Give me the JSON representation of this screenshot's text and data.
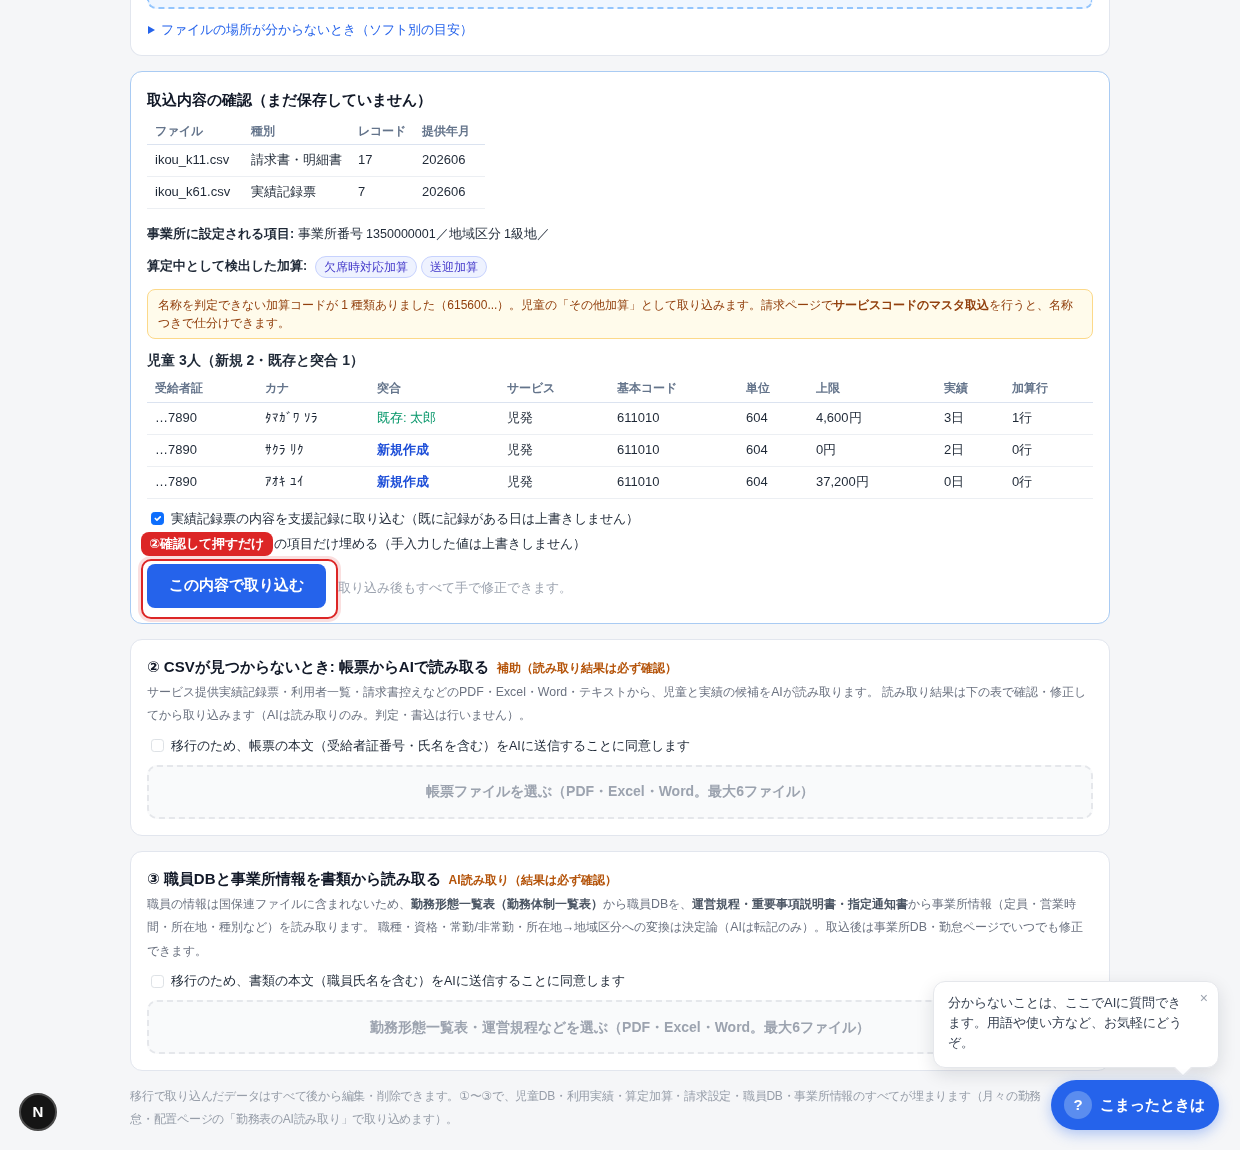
{
  "top_card": {
    "help_toggle": {
      "label": "ファイルの場所が分からないとき（ソフト別の目安）",
      "expanded": false
    }
  },
  "review_card": {
    "title": "取込内容の確認（まだ保存していません）",
    "files_table": {
      "columns": [
        "ファイル",
        "種別",
        "レコード",
        "提供年月"
      ],
      "rows": [
        [
          "ikou_k11.csv",
          "請求書・明細書",
          "17",
          "202606"
        ],
        [
          "ikou_k61.csv",
          "実績記録票",
          "7",
          "202606"
        ]
      ]
    },
    "office_settings": "**事業所に設定される項目:** 事業所番号 1350000001／地域区分 1級地／",
    "detected_additions": {
      "label": "算定中として検出した加算:",
      "tags": [
        "欠席時対応加算",
        "送迎加算"
      ]
    },
    "warning": "名称を判定できない加算コードが 1 種類ありました（615600...）。児童の「その他加算」として取り込みます。請求ページで**サービスコードのマスタ取込**を行うと、名称つきで仕分けできます。",
    "children_heading": "児童 3人（新規 2・既存と突合 1）",
    "children_table": {
      "columns": [
        "受給者証",
        "カナ",
        "突合",
        "サービス",
        "基本コード",
        "単位",
        "上限",
        "実績",
        "加算行"
      ],
      "rows": [
        {
          "recipient": "…7890",
          "kana": "ﾀﾏｶﾞﾜ ｿﾗ",
          "match": {
            "kind": "existing",
            "text": "既存: 太郎"
          },
          "service": "児発",
          "base_code": "611010",
          "units": "604",
          "cap": "4,600円",
          "actual": "3日",
          "addition_rows": "1行"
        },
        {
          "recipient": "…7890",
          "kana": "ｻｸﾗ ﾘｸ",
          "match": {
            "kind": "new",
            "text": "新規作成"
          },
          "service": "児発",
          "base_code": "611010",
          "units": "604",
          "cap": "0円",
          "actual": "2日",
          "addition_rows": "0行"
        },
        {
          "recipient": "…7890",
          "kana": "ｱｵｷ ﾕｲ",
          "match": {
            "kind": "new",
            "text": "新規作成"
          },
          "service": "児発",
          "base_code": "611010",
          "units": "604",
          "cap": "37,200円",
          "actual": "0日",
          "addition_rows": "0行"
        }
      ]
    },
    "options": [
      {
        "kind": "checkbox",
        "label": "実績記録票の内容を支援記録に取り込む（既に記録がある日は上書きしません）",
        "checked": true
      },
      {
        "kind": "covered",
        "callout": "②確認して押すだけ",
        "label": "の項目だけ埋める（手入力した値は上書きしません）"
      }
    ],
    "import_button": {
      "label": "この内容で取り込む",
      "highlighted": true
    },
    "import_note": "取り込み後もすべて手で修正できます。"
  },
  "ai_cards": [
    {
      "title": "② CSVが見つからないとき: 帳票からAIで読み取る",
      "tag": "補助（読み取り結果は必ず確認）",
      "description": "サービス提供実績記録票・利用者一覧・請求書控えなどのPDF・Excel・Word・テキストから、児童と実績の候補をAIが読み取ります。 読み取り結果は下の表で確認・修正してから取り込みます（AIは読み取りのみ。判定・書込は行いません）。",
      "consent": {
        "label": "移行のため、帳票の本文（受給者証番号・氏名を含む）をAIに送信することに同意します",
        "checked": false
      },
      "dropzone": {
        "label": "帳票ファイルを選ぶ（PDF・Excel・Word。最大6ファイル）",
        "disabled": true
      }
    },
    {
      "title": "③ 職員DBと事業所情報を書類から読み取る",
      "tag": "AI読み取り（結果は必ず確認）",
      "description": "職員の情報は国保連ファイルに含まれないため、**勤務形態一覧表（勤務体制一覧表）**から職員DBを、**運営規程・重要事項説明書・指定通知書**から事業所情報（定員・営業時間・所在地・種別など）を読み取ります。 職種・資格・常勤/非常勤・所在地→地域区分への変換は決定論（AIは転記のみ）。取込後は事業所DB・勤怠ページでいつでも修正できます。",
      "consent": {
        "label": "移行のため、書類の本文（職員氏名を含む）をAIに送信することに同意します",
        "checked": false
      },
      "dropzone": {
        "label": "勤務形態一覧表・運営規程などを選ぶ（PDF・Excel・Word。最大6ファイル）",
        "disabled": true
      }
    }
  ],
  "footer_note": [
    "移行で取り込んだデータはすべて後から編集・削除できます。①〜③で、児童DB・利用実績・算定加算・請求設定・職員DB・事業所情報のすべてが埋まります（月々の勤務",
    "怠・配置ページの「勤務表のAI読み取り」で取り込めます）。"
  ],
  "help": {
    "bubble": {
      "text": "分からないことは、ここでAIに質問できます。用語や使い方など、お気軽にどうぞ。",
      "close": "×"
    },
    "button": {
      "icon_text": "?",
      "label": "こまったときは"
    }
  },
  "dev_button": {
    "label": "N"
  }
}
